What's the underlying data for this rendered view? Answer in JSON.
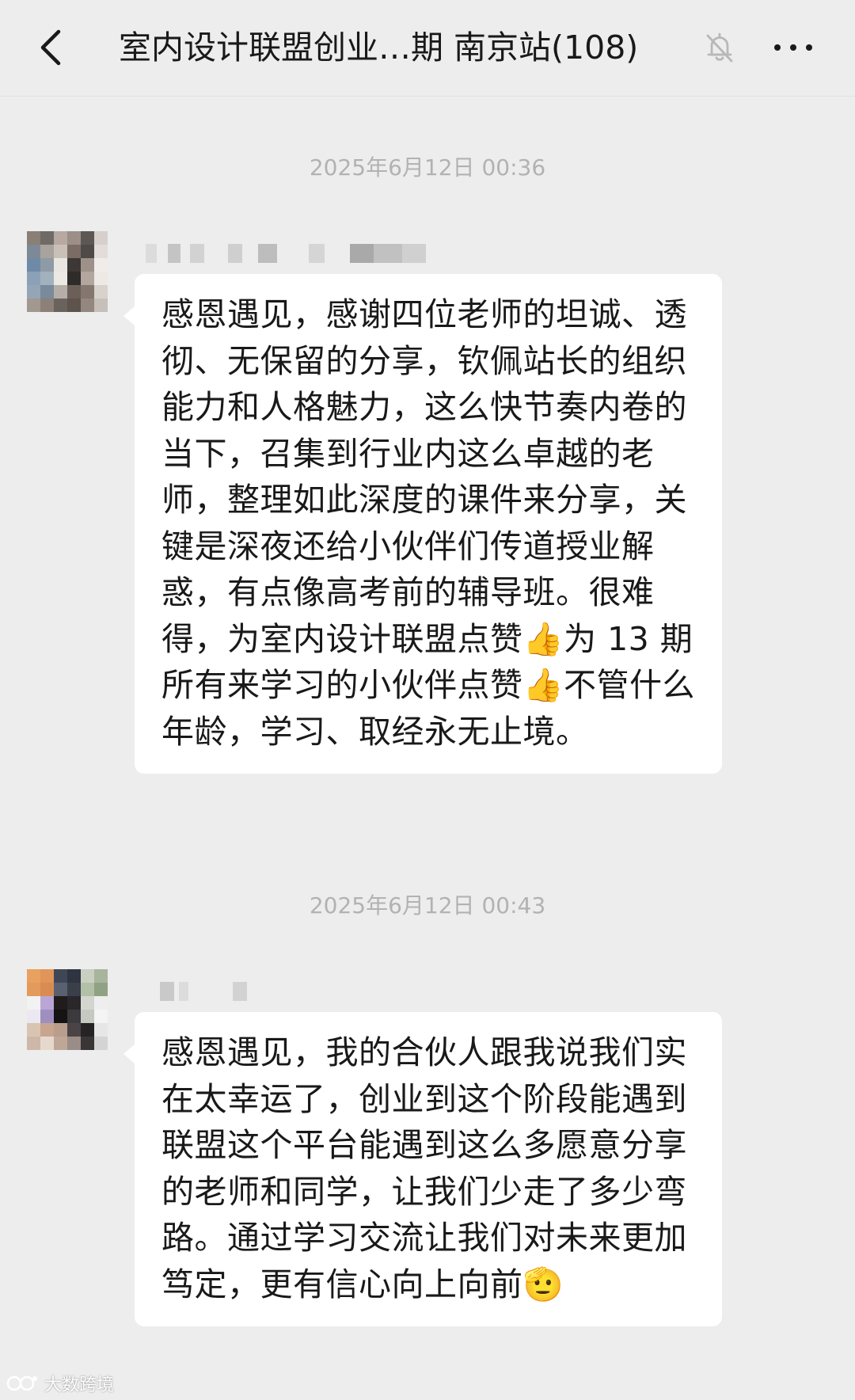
{
  "header": {
    "title": "室内设计联盟创业…期 南京站(108)",
    "back_icon": "chevron-left-icon",
    "mute_icon": "bell-off-icon",
    "more_icon": "more-horizontal-icon"
  },
  "messages": [
    {
      "timestamp": "2025年6月12日 00:36",
      "sender": "",
      "text": "感恩遇见，感谢四位老师的坦诚、透彻、无保留的分享，钦佩站长的组织能力和人格魅力，这么快节奏内卷的当下，召集到行业内这么卓越的老师，整理如此深度的课件来分享，关键是深夜还给小伙伴们传道授业解惑，有点像高考前的辅导班。很难得，为室内设计联盟点赞👍为 13 期所有来学习的小伙伴点赞👍不管什么年龄，学习、取经永无止境。"
    },
    {
      "timestamp": "2025年6月12日 00:43",
      "sender": "",
      "text": "感恩遇见，我的合伙人跟我说我们实在太幸运了，创业到这个阶段能遇到联盟这个平台能遇到这么多愿意分享的老师和同学，让我们少走了多少弯路。通过学习交流让我们对未来更加笃定，更有信心向上向前🫡"
    }
  ],
  "watermark": "大数跨境",
  "colors": {
    "background": "#ededed",
    "bubble": "#ffffff",
    "text": "#191919",
    "timestamp": "#b2b2b2"
  }
}
